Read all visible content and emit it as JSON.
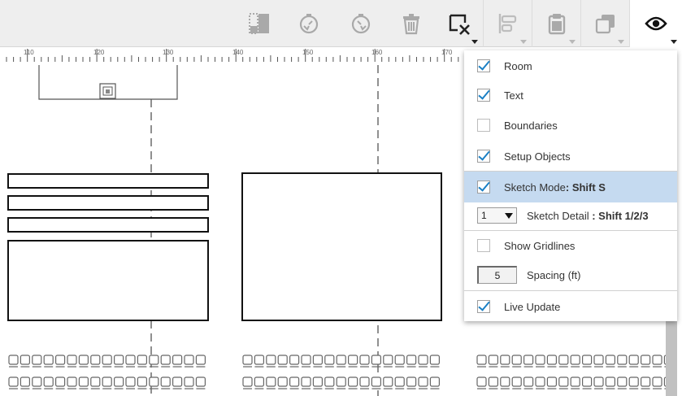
{
  "toolbar": {
    "buttons": [
      {
        "name": "split-view-icon"
      },
      {
        "name": "timer-back-icon"
      },
      {
        "name": "timer-forward-icon"
      },
      {
        "name": "trash-icon"
      },
      {
        "name": "deselect-icon"
      },
      {
        "name": "align-icon"
      },
      {
        "name": "clipboard-icon"
      },
      {
        "name": "copy-icon"
      },
      {
        "name": "eye-icon"
      }
    ]
  },
  "ruler": {
    "labels": [
      "110",
      "120",
      "130",
      "140",
      "150",
      "160",
      "170"
    ]
  },
  "menu": {
    "room": {
      "label": "Room",
      "checked": true
    },
    "text": {
      "label": "Text",
      "checked": true
    },
    "boundaries": {
      "label": "Boundaries",
      "checked": false
    },
    "setup_objects": {
      "label": "Setup Objects",
      "checked": true
    },
    "sketch_mode": {
      "label": "Sketch Mode",
      "shortcut": ": Shift S",
      "checked": true
    },
    "sketch_detail": {
      "value": "1",
      "label": "Sketch Detail ",
      "shortcut": ": Shift 1/2/3"
    },
    "show_gridlines": {
      "label": "Show Gridlines",
      "checked": false
    },
    "spacing": {
      "value": "5",
      "label": "Spacing (ft)"
    },
    "live_update": {
      "label": "Live Update",
      "checked": true
    }
  },
  "colors": {
    "accent_check": "#1a7fc4",
    "highlight": "#c5daf0",
    "toolbar_bg": "#eeeeee"
  }
}
